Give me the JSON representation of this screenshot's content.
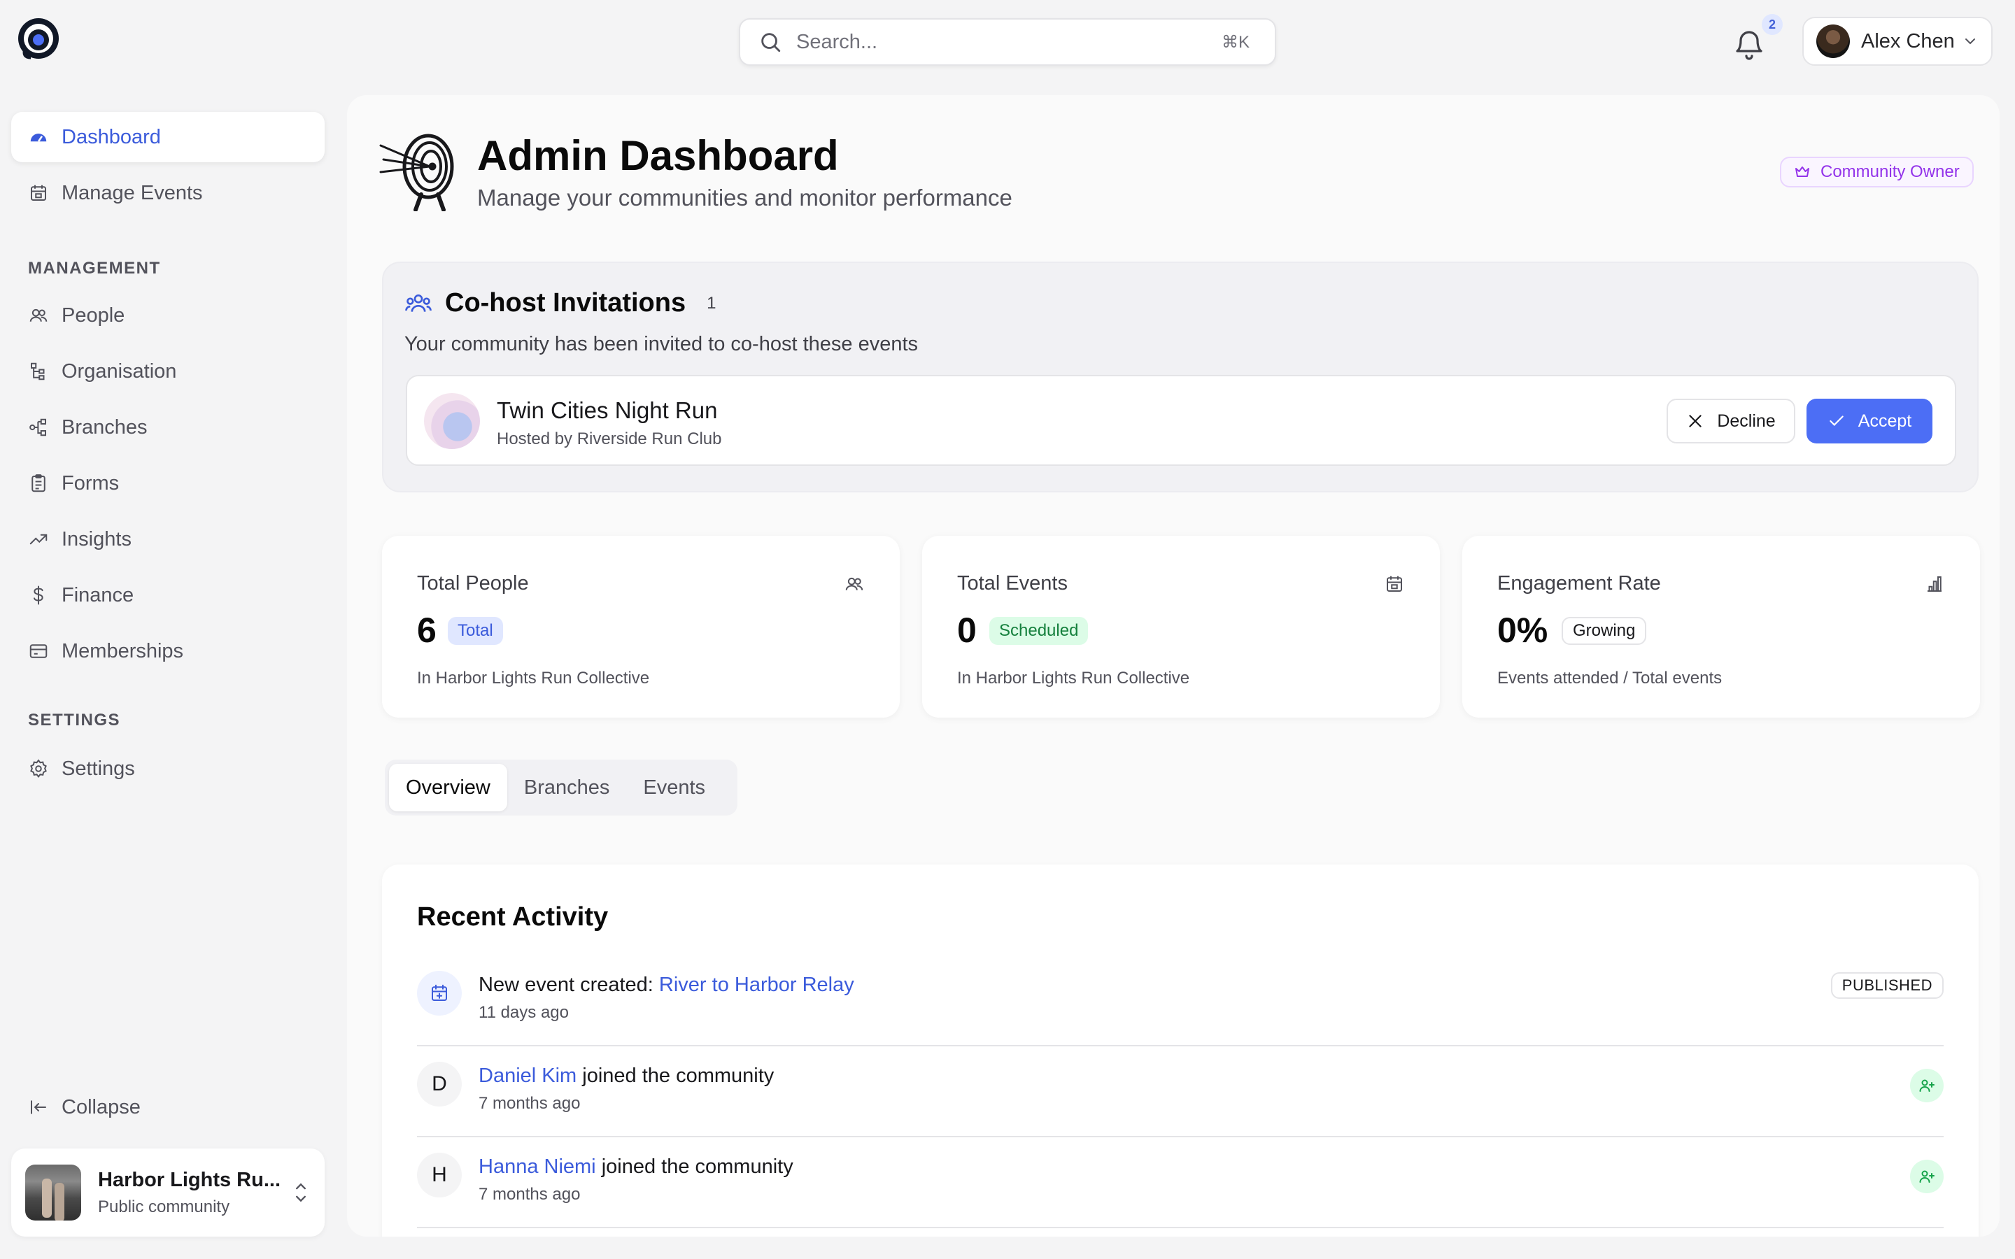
{
  "search": {
    "placeholder": "Search...",
    "shortcut": "⌘K"
  },
  "header": {
    "notification_count": "2",
    "user_name": "Alex Chen"
  },
  "sidebar": {
    "top_items": [
      {
        "label": "Dashboard",
        "icon": "dashboard-icon"
      },
      {
        "label": "Manage Events",
        "icon": "calendar-icon"
      }
    ],
    "management_title": "MANAGEMENT",
    "management_items": [
      {
        "label": "People",
        "icon": "people-icon"
      },
      {
        "label": "Organisation",
        "icon": "org-tree-icon"
      },
      {
        "label": "Branches",
        "icon": "branches-icon"
      },
      {
        "label": "Forms",
        "icon": "clipboard-icon"
      },
      {
        "label": "Insights",
        "icon": "trend-icon"
      },
      {
        "label": "Finance",
        "icon": "dollar-icon"
      },
      {
        "label": "Memberships",
        "icon": "card-icon"
      }
    ],
    "settings_title": "SETTINGS",
    "settings_items": [
      {
        "label": "Settings",
        "icon": "gear-icon"
      }
    ],
    "collapse_label": "Collapse",
    "community": {
      "name": "Harbor Lights Ru...",
      "status": "Public community"
    }
  },
  "page": {
    "title": "Admin Dashboard",
    "subtitle": "Manage your communities and monitor performance",
    "role_badge": "Community Owner"
  },
  "cohost": {
    "title": "Co-host Invitations",
    "count": "1",
    "description": "Your community has been invited to co-host these events",
    "invitation": {
      "event_name": "Twin Cities Night Run",
      "host": "Hosted by Riverside Run Club",
      "decline_label": "Decline",
      "accept_label": "Accept"
    }
  },
  "stats": [
    {
      "title": "Total People",
      "value": "6",
      "badge": "Total",
      "footer": "In Harbor Lights Run Collective",
      "icon": "people-icon"
    },
    {
      "title": "Total Events",
      "value": "0",
      "badge": "Scheduled",
      "footer": "In Harbor Lights Run Collective",
      "icon": "calendar-icon"
    },
    {
      "title": "Engagement Rate",
      "value": "0%",
      "badge": "Growing",
      "footer": "Events attended / Total events",
      "icon": "bar-chart-icon"
    }
  ],
  "tabs": [
    {
      "label": "Overview"
    },
    {
      "label": "Branches"
    },
    {
      "label": "Events"
    }
  ],
  "activity": {
    "title": "Recent Activity",
    "items": [
      {
        "prefix": "New event created: ",
        "link": "River to Harbor Relay",
        "suffix": "",
        "ago": "11 days ago",
        "status": "PUBLISHED"
      },
      {
        "avatar": "D",
        "prefix": "",
        "link": "Daniel Kim",
        "suffix": " joined the community",
        "ago": "7 months ago"
      },
      {
        "avatar": "H",
        "prefix": "",
        "link": "Hanna Niemi",
        "suffix": " joined the community",
        "ago": "7 months ago"
      }
    ]
  },
  "colors": {
    "accent": "#3b5bdb",
    "accept_button": "#4c6ef5",
    "owner_badge": "#9333ea",
    "success": "#15803d"
  }
}
